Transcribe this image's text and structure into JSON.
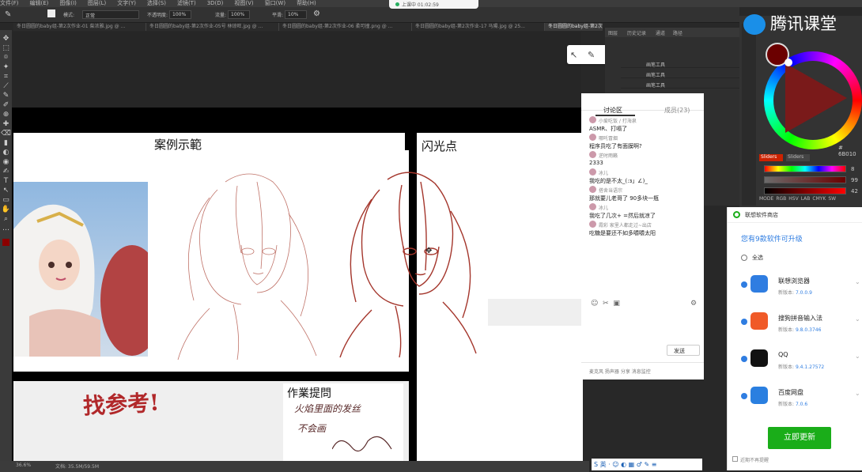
{
  "menubar": [
    "文件(F)",
    "编辑(E)",
    "图像(I)",
    "图层(L)",
    "文字(Y)",
    "选择(S)",
    "滤镜(T)",
    "3D(D)",
    "视图(V)",
    "窗口(W)",
    "帮助(H)"
  ],
  "options": {
    "mode_label": "模式:",
    "mode_value": "正常",
    "opacity_label": "不透明度:",
    "opacity_value": "100%",
    "flow_label": "流量:",
    "flow_value": "100%",
    "smooth_label": "平滑:",
    "smooth_value": "10%"
  },
  "recording": "上课中 01:02:59",
  "doc_tabs": [
    "冬日圆圆的baby组-第2次作业-01 柴浓雅.jpg @ ...",
    "冬日圆圆的baby组-第2次作业-05号 林琼旺.jpg @ ...",
    "冬日圆圆的baby组-第2次作业-06 柔可撞.png @ ...",
    "冬日圆圆的baby组-第2次作业-17 马陽.jpg @ 25...",
    "冬日圆圆的baby组-第2次作业-24 ..."
  ],
  "canvas": {
    "sample_title": "案例示範",
    "flash_title": "闪光点",
    "homework_title": "作業提問",
    "stamp_text": "找参考!",
    "handwriting": [
      "火焰里面的发丝",
      "不会画"
    ]
  },
  "layers_panel": {
    "tabs": [
      "图层",
      "历史记录",
      "通道",
      "路径"
    ],
    "rows": [
      "画笔工具",
      "画笔工具",
      "画笔工具"
    ]
  },
  "brand": {
    "name": "腾讯课堂",
    "accent": "#1a8fe8"
  },
  "color_panel": {
    "hex": "# 6B010",
    "tabs": [
      "Sliders",
      "Sliders"
    ],
    "h_val": "8",
    "s_val": "99",
    "v_val": "42",
    "modes": [
      "MODE",
      "RGB",
      "HSV",
      "LAB",
      "CMYK",
      "SW"
    ]
  },
  "chat": {
    "tab_discussion": "讨论区",
    "tab_members": "成员(23)",
    "messages": [
      {
        "name": "小爱吃饭 / 打海泉",
        "text": "ASMR、打嗝了"
      },
      {
        "name": "哪吒冒烟",
        "text": "程序员吃了有面膜啊?"
      },
      {
        "name": "逆时雨籁",
        "text": "2333"
      },
      {
        "name": "冰儿",
        "text": "我吃的是不太_(:з」∠)_"
      },
      {
        "name": "搭舍当语宗",
        "text": "那就要儿老哥了 90多块一瓶"
      },
      {
        "name": "冰儿",
        "text": "我吃了几次+ =然后就凉了"
      },
      {
        "name": "霞彩 家里人都走过~出店",
        "text": "吃糖是要还不如多嚼嚼太阳"
      }
    ],
    "send": "发送",
    "footer": "麦克风 扬声器 分享 消息监控"
  },
  "store": {
    "title": "联想软件商店",
    "subtitle": "您有9款软件可升级",
    "select_all": "全选",
    "apps": [
      {
        "name": "联想浏览器",
        "ver_label": "新版本:",
        "ver": "7.0.0.9",
        "color": "#2f7de1"
      },
      {
        "name": "搜狗拼音输入法",
        "ver_label": "新版本:",
        "ver": "9.8.0.3746",
        "color": "#f05a28"
      },
      {
        "name": "QQ",
        "ver_label": "新版本:",
        "ver": "9.4.1.27572",
        "color": "#111"
      },
      {
        "name": "百度网盘",
        "ver_label": "新版本:",
        "ver": "7.0.6",
        "color": "#2a7fe0"
      }
    ],
    "update_btn": "立即更新",
    "no_remind": "近期不再提醒"
  },
  "status": {
    "zoom": "36.6%",
    "doc": "文档: 35.5M/59.5M"
  },
  "ime": "S 英 · ☺ ◐ ▦ ♂ ✎ ≡"
}
